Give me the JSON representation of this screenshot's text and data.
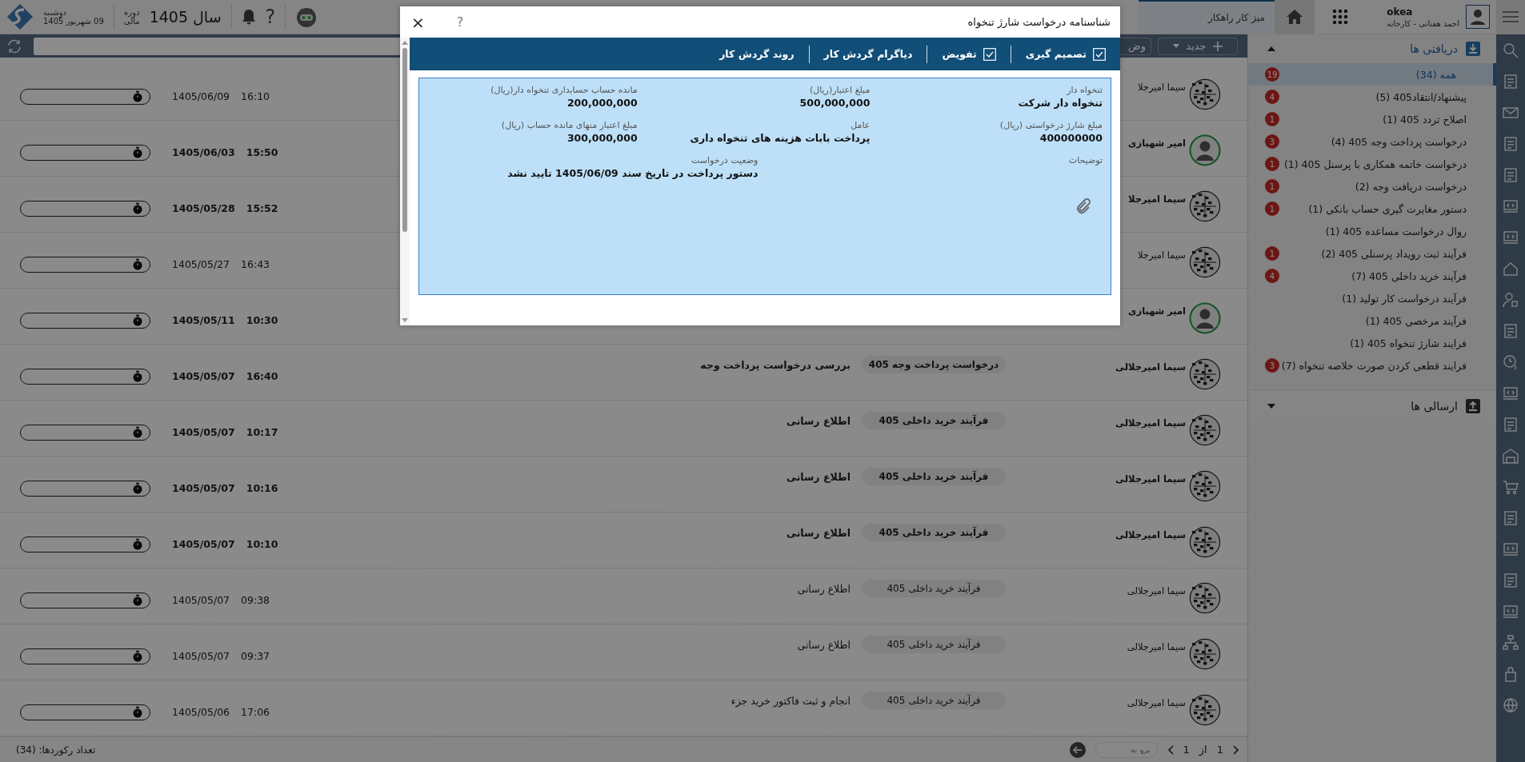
{
  "topbar": {
    "user": {
      "name": "okea",
      "subtitle": "احمد هفتانی - کارخانه"
    },
    "tab": {
      "label": "میز کار راهکار",
      "selected": true
    },
    "date": {
      "weekday": "دوشنبه",
      "date": "09 شهریور 1405"
    },
    "period": {
      "line1": "دوره",
      "line2": "مالی"
    },
    "year": "سال 1405",
    "help": "?"
  },
  "toolbar": {
    "new_button": "جدید",
    "button_2": "وض"
  },
  "sidebar": {
    "inbox": {
      "label": "دریافتی ها",
      "expanded": true,
      "items": [
        {
          "label": "همه (34)",
          "badge": "19",
          "selected": true
        },
        {
          "label": "پیشنهاد/انتقاد405 (5)",
          "badge": "4",
          "selected": false
        },
        {
          "label": "اصلاح تردد 405 (1)",
          "badge": "1",
          "selected": false
        },
        {
          "label": "درخواست پرداخت وجه 405 (4)",
          "badge": "3",
          "selected": false
        },
        {
          "label": "درخواست خاتمه همکاری با پرسنل 405 (1)",
          "badge": "1",
          "selected": false
        },
        {
          "label": "درخواست دریافت وجه (2)",
          "badge": "1",
          "selected": false
        },
        {
          "label": "دستور مغایرت گیری حساب بانکی (1)",
          "badge": "1",
          "selected": false
        },
        {
          "label": "روال درخواست مساعده 405 (1)",
          "selected": false
        },
        {
          "label": "فرآیند ثبت رویداد پرسنلی 405 (2)",
          "badge": "1",
          "selected": false
        },
        {
          "label": "فرآیند خرید داخلی 405 (7)",
          "badge": "4",
          "selected": false
        },
        {
          "label": "فرآیند درخواست کار تولید (1)",
          "selected": false
        },
        {
          "label": "فرآیند مرخصی 405 (1)",
          "selected": false
        },
        {
          "label": "فرایند شارژ تنخواه 405 (1)",
          "selected": false
        },
        {
          "label": "فرایند قطعی کردن صورت خلاصه تنخواه (7)",
          "badge": "3",
          "selected": false
        }
      ]
    },
    "outbox": {
      "label": "ارسالی ها",
      "expanded": false
    }
  },
  "rows": [
    {
      "name": "سیما امیرجلا",
      "kind": "pattern",
      "unread": false,
      "date": "1405/06/09",
      "time": "16:10"
    },
    {
      "name": "امیر شهبازی",
      "kind": "person",
      "unread": true,
      "date": "1405/06/03",
      "time": "15:50"
    },
    {
      "name": "سیما امیرجلا",
      "kind": "pattern",
      "unread": true,
      "date": "1405/05/28",
      "time": "15:52"
    },
    {
      "name": "سیما امیرجلا",
      "kind": "pattern",
      "unread": false,
      "date": "1405/05/27",
      "time": "16:43"
    },
    {
      "name": "امیر شهبازی",
      "kind": "person",
      "unread": true,
      "date": "1405/05/11",
      "time": "10:30"
    },
    {
      "name": "سیما امیرجلالی",
      "kind": "pattern",
      "unread": true,
      "process": "درخواست پرداخت وجه 405",
      "action": "بررسی درخواست پرداخت وجه",
      "date": "1405/05/07",
      "time": "16:40"
    },
    {
      "name": "سیما امیرجلالی",
      "kind": "pattern",
      "unread": true,
      "process": "فرآیند خرید داخلی 405",
      "action": "اطلاع رسانی",
      "date": "1405/05/07",
      "time": "10:17"
    },
    {
      "name": "سیما امیرجلالی",
      "kind": "pattern",
      "unread": true,
      "process": "فرآیند خرید داخلی 405",
      "action": "اطلاع رسانی",
      "date": "1405/05/07",
      "time": "10:16"
    },
    {
      "name": "سیما امیرجلالی",
      "kind": "pattern",
      "unread": true,
      "process": "فرآیند خرید داخلی 405",
      "action": "اطلاع رسانی",
      "date": "1405/05/07",
      "time": "10:10"
    },
    {
      "name": "سیما امیرجلالی",
      "kind": "pattern",
      "unread": false,
      "process": "فرآیند خرید داخلی 405",
      "action": "اطلاع رسانی",
      "date": "1405/05/07",
      "time": "09:38"
    },
    {
      "name": "سیما امیرجلالی",
      "kind": "pattern",
      "unread": false,
      "process": "فرآیند خرید داخلی 405",
      "action": "اطلاع رسانی",
      "date": "1405/05/07",
      "time": "09:37"
    },
    {
      "name": "سیما امیرجلالی",
      "kind": "pattern",
      "unread": false,
      "process": "فرآیند خرید داخلی 405",
      "action": "انجام و ثبت فاکتور خرید جزء",
      "date": "1405/05/06",
      "time": "17:06"
    }
  ],
  "footer": {
    "pagination": {
      "current": "1",
      "of": "از",
      "total": "1",
      "goto_placeholder": "برو به"
    },
    "record_count": "تعداد رکوردها: (34)"
  },
  "dialog": {
    "title": "شناسنامه درخواست شارژ تنخواه",
    "help": "?",
    "close": "×",
    "actions": [
      "تصمیم گیری",
      "تفویض",
      "دیاگرام گردش کار",
      "روند گردش کار"
    ],
    "fields": [
      {
        "label": "تنخواه دار",
        "value": "تنخواه دار شرکت"
      },
      {
        "label": "مبلغ اعتبار(ریال)",
        "value": "500,000,000"
      },
      {
        "label": "مانده حساب حسابداری تنخواه دار(ریال)",
        "value": "200,000,000"
      },
      {
        "label": "مبلغ شارژ درخواستی (ریال)",
        "value": "400000000"
      },
      {
        "label": "عامل",
        "value": "پرداخت بابات هزینه های تنخواه داری"
      },
      {
        "label": "مبلغ اعتبار منهای مانده حساب (ریال)",
        "value": "300,000,000"
      },
      {
        "label": "توضیحات"
      },
      {
        "label": "وضعیت درخواست",
        "value": "دستور پرداخت در تاریخ سند 1405/06/09 تایید نشد"
      }
    ]
  }
}
